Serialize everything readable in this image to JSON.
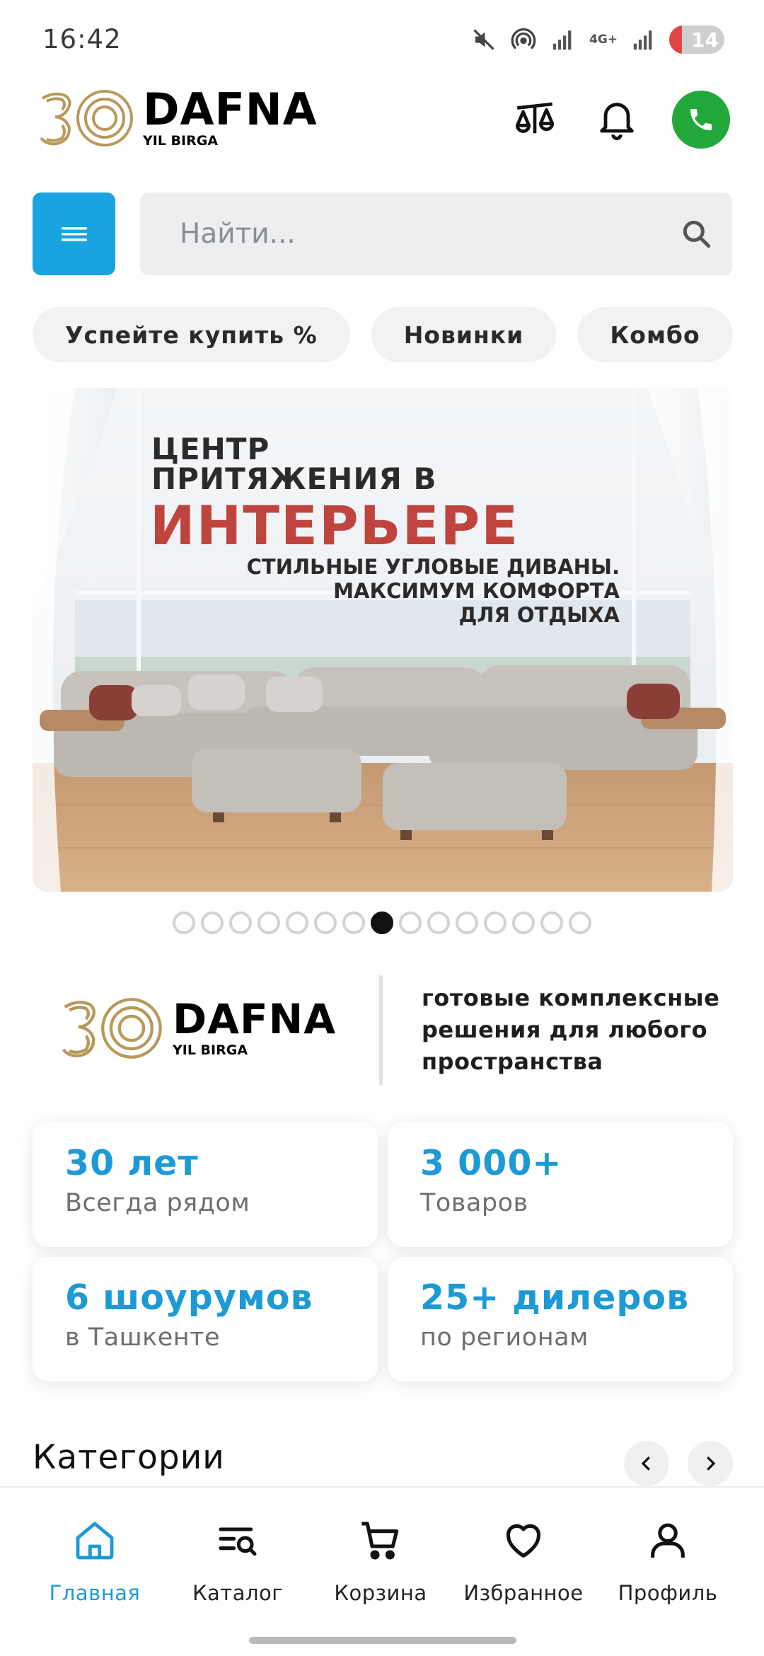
{
  "status_bar": {
    "time": "16:42",
    "network": "4G+",
    "battery": "14"
  },
  "header": {
    "logo": {
      "number": "30",
      "brand": "DAFNA",
      "tagline": "YIL BIRGA"
    },
    "actions": [
      "compare-icon",
      "bell-icon",
      "phone-icon"
    ]
  },
  "search": {
    "placeholder": "Найти..."
  },
  "chips": [
    "Успейте купить %",
    "Новинки",
    "Комбо"
  ],
  "banner": {
    "line1": "ЦЕНТР",
    "line2": "ПРИТЯЖЕНИЯ В",
    "line3": "ИНТЕРЬЕРЕ",
    "sub1": "СТИЛЬНЫЕ УГЛОВЫЕ ДИВАНЫ.",
    "sub2": "МАКСИМУМ КОМФОРТА",
    "sub3": "ДЛЯ ОТДЫХА"
  },
  "carousel": {
    "total": 15,
    "active_index": 8
  },
  "about": {
    "logo": {
      "number": "30",
      "brand": "DAFNA",
      "tagline": "YIL BIRGA"
    },
    "slogan": "готовые комплексные решения для любого пространства"
  },
  "stats": [
    {
      "big": "30 лет",
      "small": "Всегда рядом"
    },
    {
      "big": "3 000+",
      "small": "Товаров"
    },
    {
      "big": "6 шоурумов",
      "small": "в Ташкенте"
    },
    {
      "big": "25+ дилеров",
      "small": "по регионам"
    }
  ],
  "categories": {
    "title": "Категории"
  },
  "bottom_nav": [
    {
      "label": "Главная",
      "icon": "home-icon",
      "active": true
    },
    {
      "label": "Каталог",
      "icon": "catalog-search-icon",
      "active": false
    },
    {
      "label": "Корзина",
      "icon": "cart-icon",
      "active": false
    },
    {
      "label": "Избранное",
      "icon": "heart-icon",
      "active": false
    },
    {
      "label": "Профиль",
      "icon": "user-icon",
      "active": false
    }
  ],
  "colors": {
    "accent": "#1c9ad6",
    "menu_button": "#19a3e1",
    "call_button": "#22a83a",
    "banner_red": "#c0443e",
    "logo_gold": "#b8995a"
  }
}
